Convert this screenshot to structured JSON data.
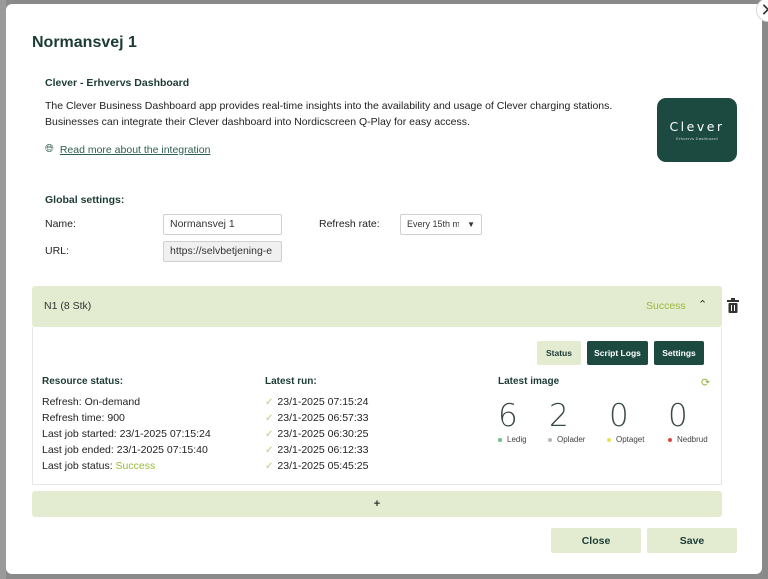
{
  "modal": {
    "title": "Normansvej 1",
    "close_glyph": "✕"
  },
  "app": {
    "name": "Clever - Erhvervs Dashboard",
    "description": "The Clever Business Dashboard app provides real-time insights into the availability and usage of Clever charging stations. Businesses can integrate their Clever dashboard into Nordicscreen Q-Play for easy access.",
    "read_more": "Read more about the integration",
    "logo_text": "Clever",
    "logo_subtext": "Erhvervs Dashboard"
  },
  "global_settings": {
    "heading": "Global settings:",
    "name_label": "Name:",
    "name_value": "Normansvej 1",
    "url_label": "URL:",
    "url_value": "https://selvbetjening-e",
    "refresh_label": "Refresh rate:",
    "refresh_value": "Every 15th m"
  },
  "script": {
    "name": "N1 (8 Stk)",
    "status": "Success",
    "buttons": {
      "status": "Status",
      "logs": "Script Logs",
      "settings": "Settings"
    },
    "resource_status": {
      "heading": "Resource status:",
      "refresh": "Refresh: On-demand",
      "refresh_time": "Refresh time: 900",
      "last_started": "Last job started: 23/1-2025 07:15:24",
      "last_ended": "Last job ended: 23/1-2025 07:15:40",
      "last_status_label": "Last job status: ",
      "last_status_value": "Success"
    },
    "latest_run": {
      "heading": "Latest run:",
      "runs": [
        "23/1-2025 07:15:24",
        "23/1-2025 06:57:33",
        "23/1-2025 06:30:25",
        "23/1-2025 06:12:33",
        "23/1-2025 05:45:25"
      ]
    },
    "latest_image": {
      "heading": "Latest image",
      "stats": [
        {
          "value": "6",
          "label": "Ledig",
          "color": "#6fbf8e"
        },
        {
          "value": "2",
          "label": "Oplader",
          "color": "#b8b8b8"
        },
        {
          "value": "0",
          "label": "Optaget",
          "color": "#f0dc5a"
        },
        {
          "value": "0",
          "label": "Nedbrud",
          "color": "#e0443a"
        }
      ]
    }
  },
  "footer": {
    "add_label": "+",
    "close_label": "Close",
    "save_label": "Save"
  },
  "icons": {
    "globe": "globe-icon",
    "check": "check-icon",
    "refresh": "refresh-icon",
    "trash": "trash-icon",
    "chevron_up": "chevron-up-icon",
    "chevron_down": "chevron-down-icon"
  },
  "colors": {
    "brand_dark": "#1c4a41",
    "accent_light": "#e3ebd1",
    "success": "#9ab93a"
  }
}
